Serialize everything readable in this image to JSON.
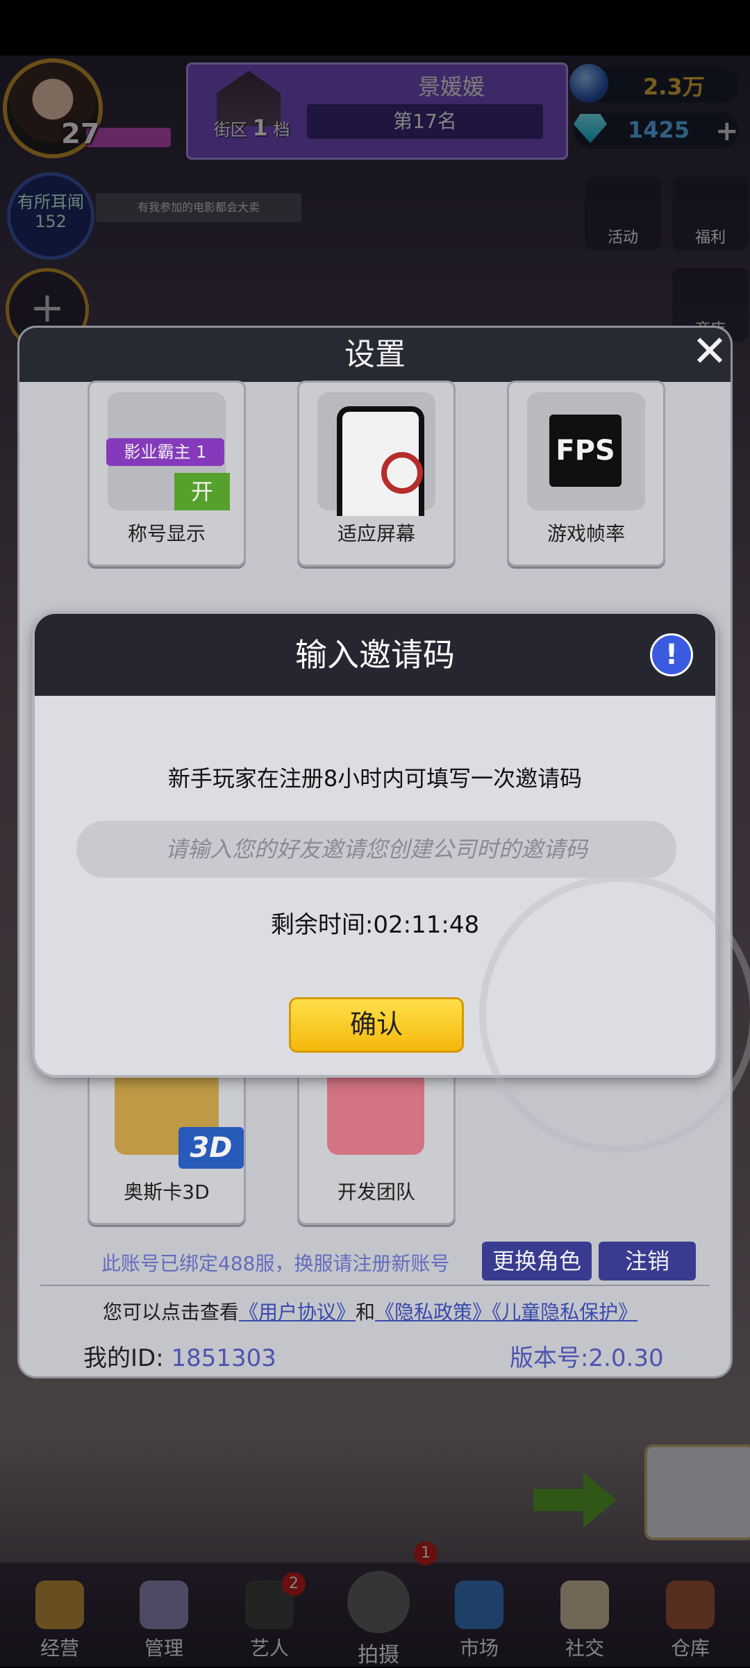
{
  "player": {
    "level": "27",
    "name": "景媛媛",
    "district_prefix": "街区",
    "district_num": "1",
    "district_suffix": "档",
    "rank": "第17名"
  },
  "currency": {
    "coins": "2.3万",
    "gems": "1425",
    "add_icon": "plus-icon"
  },
  "news": {
    "label": "有所耳闻",
    "count": "152",
    "ticker": "有我参加的电影都会大卖"
  },
  "side": {
    "activity": "活动",
    "welfare": "福利",
    "shop": "商店"
  },
  "settings": {
    "title": "设置",
    "cards": [
      {
        "label": "称号显示",
        "badge": "影业霸主 1",
        "toggle": "开"
      },
      {
        "label": "适应屏幕"
      },
      {
        "label": "游戏帧率",
        "icon_text": "FPS"
      },
      {
        "label": "奥斯卡3D",
        "icon_text": "3D"
      },
      {
        "label": "开发团队"
      }
    ],
    "account_note": "此账号已绑定488服，换服请注册新账号",
    "switch_role": "更换角色",
    "logout": "注销",
    "agree_prefix": "您可以点击查看",
    "link_user": "《用户协议》",
    "and": "和",
    "link_privacy": "《隐私政策》",
    "link_child": "《儿童隐私保护》",
    "id_label": "我的ID:",
    "id_value": "1851303",
    "version": "版本号:2.0.30"
  },
  "invite": {
    "title": "输入邀请码",
    "info": "!",
    "description": "新手玩家在注册8小时内可填写一次邀请码",
    "placeholder": "请输入您的好友邀请您创建公司时的邀请码",
    "remaining": "剩余时间:02:11:48",
    "confirm": "确认"
  },
  "nav": [
    {
      "label": "经营"
    },
    {
      "label": "管理"
    },
    {
      "label": "艺人",
      "badge": "2"
    },
    {
      "label": "拍摄",
      "badge": "1"
    },
    {
      "label": "市场"
    },
    {
      "label": "社交"
    },
    {
      "label": "仓库"
    }
  ],
  "colors": {
    "accent_yellow": "#f5b80c",
    "panel_dark": "#25262f",
    "link_blue": "#3b4fb8"
  }
}
